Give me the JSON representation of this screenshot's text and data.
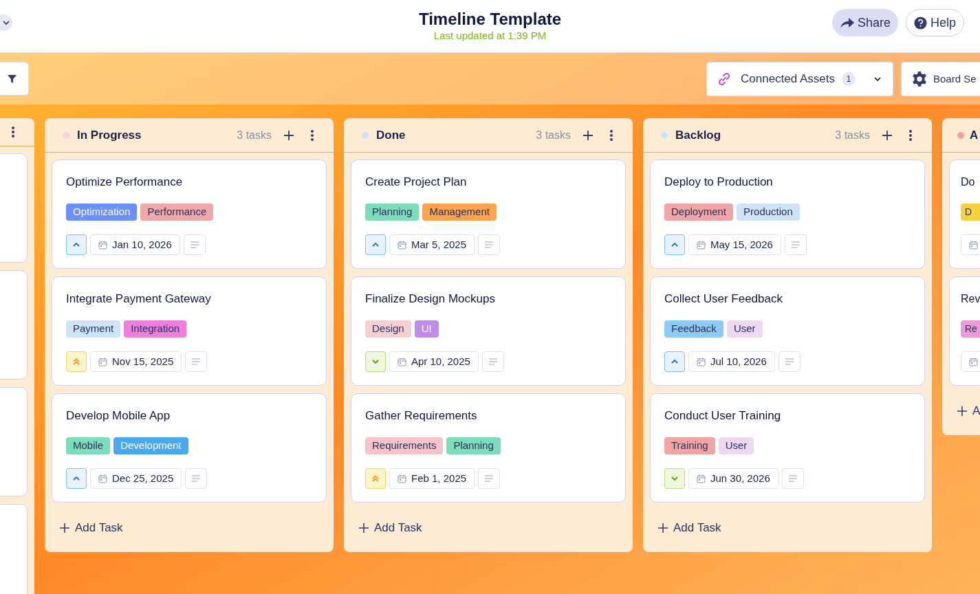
{
  "header": {
    "title": "Timeline Template",
    "subtitle": "Last updated at 1:39 PM",
    "buttons": [
      {
        "kind": "share",
        "label": "Share"
      },
      {
        "kind": "help",
        "label": "Help"
      }
    ]
  },
  "toolbar": {
    "connected_assets": {
      "label": "Connected Assets",
      "count": "1"
    },
    "board_settings": {
      "label": "Board Se"
    }
  },
  "columns": [
    {
      "title": "In Progress",
      "color": "#f9d3dc",
      "count": "3 tasks",
      "add_label": "Add Task",
      "cards": [
        {
          "title": "Optimize Performance",
          "tags": [
            {
              "label": "Optimization",
              "color": "#6b8ff7"
            },
            {
              "label": "Performance",
              "color": "#f0a7a7"
            }
          ],
          "priority": {
            "kind": "medium"
          },
          "date": "Jan 10, 2026"
        },
        {
          "title": "Integrate Payment Gateway",
          "tags": [
            {
              "label": "Payment",
              "color": "#cfe3f7"
            },
            {
              "label": "Integration",
              "color": "#ee7fdd"
            }
          ],
          "priority": {
            "kind": "high"
          },
          "date": "Nov 15, 2025"
        },
        {
          "title": "Develop Mobile App",
          "tags": [
            {
              "label": "Mobile",
              "color": "#7ddcb9"
            },
            {
              "label": "Development",
              "color": "#4aa8f0"
            }
          ],
          "priority": {
            "kind": "medium"
          },
          "date": "Dec 25, 2025"
        }
      ]
    },
    {
      "title": "Done",
      "color": "#cfe3f7",
      "count": "3 tasks",
      "add_label": "Add Task",
      "cards": [
        {
          "title": "Create Project Plan",
          "tags": [
            {
              "label": "Planning",
              "color": "#7ddcb9"
            },
            {
              "label": "Management",
              "color": "#fca34d"
            }
          ],
          "priority": {
            "kind": "medium"
          },
          "date": "Mar 5, 2025"
        },
        {
          "title": "Finalize Design Mockups",
          "tags": [
            {
              "label": "Design",
              "color": "#f4cfd3"
            },
            {
              "label": "UI",
              "color": "#c08ce8"
            }
          ],
          "priority": {
            "kind": "low"
          },
          "date": "Apr 10, 2025"
        },
        {
          "title": "Gather Requirements",
          "tags": [
            {
              "label": "Requirements",
              "color": "#f4c4c9"
            },
            {
              "label": "Planning",
              "color": "#7ddcb9"
            }
          ],
          "priority": {
            "kind": "high"
          },
          "date": "Feb 1, 2025"
        }
      ]
    },
    {
      "title": "Backlog",
      "color": "#cfe3f7",
      "count": "3 tasks",
      "add_label": "Add Task",
      "cards": [
        {
          "title": "Deploy to Production",
          "tags": [
            {
              "label": "Deployment",
              "color": "#f0a4a4"
            },
            {
              "label": "Production",
              "color": "#cfe3f7"
            }
          ],
          "priority": {
            "kind": "medium"
          },
          "date": "May 15, 2026"
        },
        {
          "title": "Collect User Feedback",
          "tags": [
            {
              "label": "Feedback",
              "color": "#8ecbf3"
            },
            {
              "label": "User",
              "color": "#ecd8f0"
            }
          ],
          "priority": {
            "kind": "medium"
          },
          "date": "Jul 10, 2026"
        },
        {
          "title": "Conduct User Training",
          "tags": [
            {
              "label": "Training",
              "color": "#f0a4a4"
            },
            {
              "label": "User",
              "color": "#ecd8f0"
            }
          ],
          "priority": {
            "kind": "low"
          },
          "date": "Jun 30, 2026"
        }
      ]
    }
  ],
  "partial_column": {
    "title": "A",
    "color": "#f4a0a0",
    "add_label": "A",
    "cards": [
      {
        "title": "Do",
        "tag": {
          "label": "D",
          "color": "#f5d33f"
        }
      },
      {
        "title": "Rev",
        "tag": {
          "label": "Re",
          "color": "#ee9ad8"
        }
      }
    ]
  }
}
